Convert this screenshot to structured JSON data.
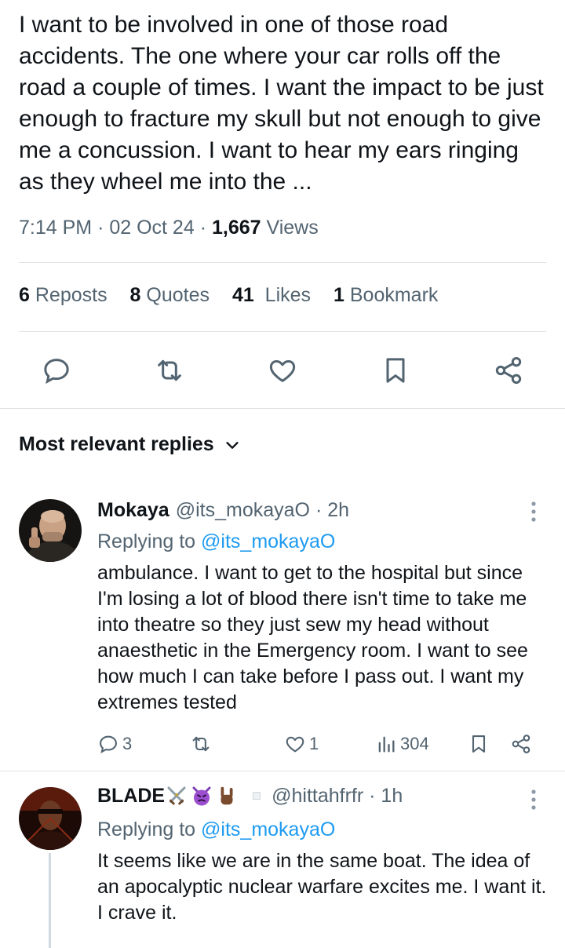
{
  "tweet": {
    "text": "I want to be involved in one of those road accidents. The one where your car rolls off the road a couple of times. I want the impact to be just enough to fracture my skull but not enough to give me a concussion. I want to hear my ears ringing as they wheel me into the ...",
    "time": "7:14 PM",
    "date": "02 Oct 24",
    "views_count": "1,667",
    "views_label": "Views",
    "sep": "·"
  },
  "stats": {
    "reposts_count": "6",
    "reposts_label": "Reposts",
    "quotes_count": "8",
    "quotes_label": "Quotes",
    "likes_count": "41",
    "likes_label": "Likes",
    "bookmarks_count": "1",
    "bookmarks_label": "Bookmark"
  },
  "sort": {
    "label": "Most relevant replies"
  },
  "replies": [
    {
      "name": "Mokaya",
      "handle": "@its_mokayaO",
      "time": "· 2h",
      "replying_prefix": "Replying to",
      "replying_to": "@its_mokayaO",
      "text": "ambulance. I want to get to the hospital but since I'm losing a lot of blood there isn't time to take me into theatre so they just sew my head without anaesthetic in the Emergency room. I want to see how much I can take before I pass out. I want my extremes tested",
      "replies_count": "3",
      "reposts_count": "",
      "likes_count": "1",
      "views_count": "304"
    },
    {
      "name": "BLADE",
      "handle": "@hittahfrfr",
      "time": "· 1h",
      "replying_prefix": "Replying to",
      "replying_to": "@its_mokayaO",
      "text": "It seems like we are in the same boat. The idea of an apocalyptic nuclear warfare excites me. I want it. I crave it."
    }
  ],
  "colors": {
    "text": "#0f1419",
    "secondary": "#536471",
    "link": "#1d9bf0",
    "divider": "#dfe3e6"
  },
  "icons": [
    "reply-icon",
    "repost-icon",
    "like-icon",
    "bookmark-icon",
    "share-icon",
    "views-icon",
    "more-icon",
    "chevron-down-icon",
    "crossed-swords-icon",
    "angry-devil-icon",
    "rock-on-hand-icon"
  ]
}
